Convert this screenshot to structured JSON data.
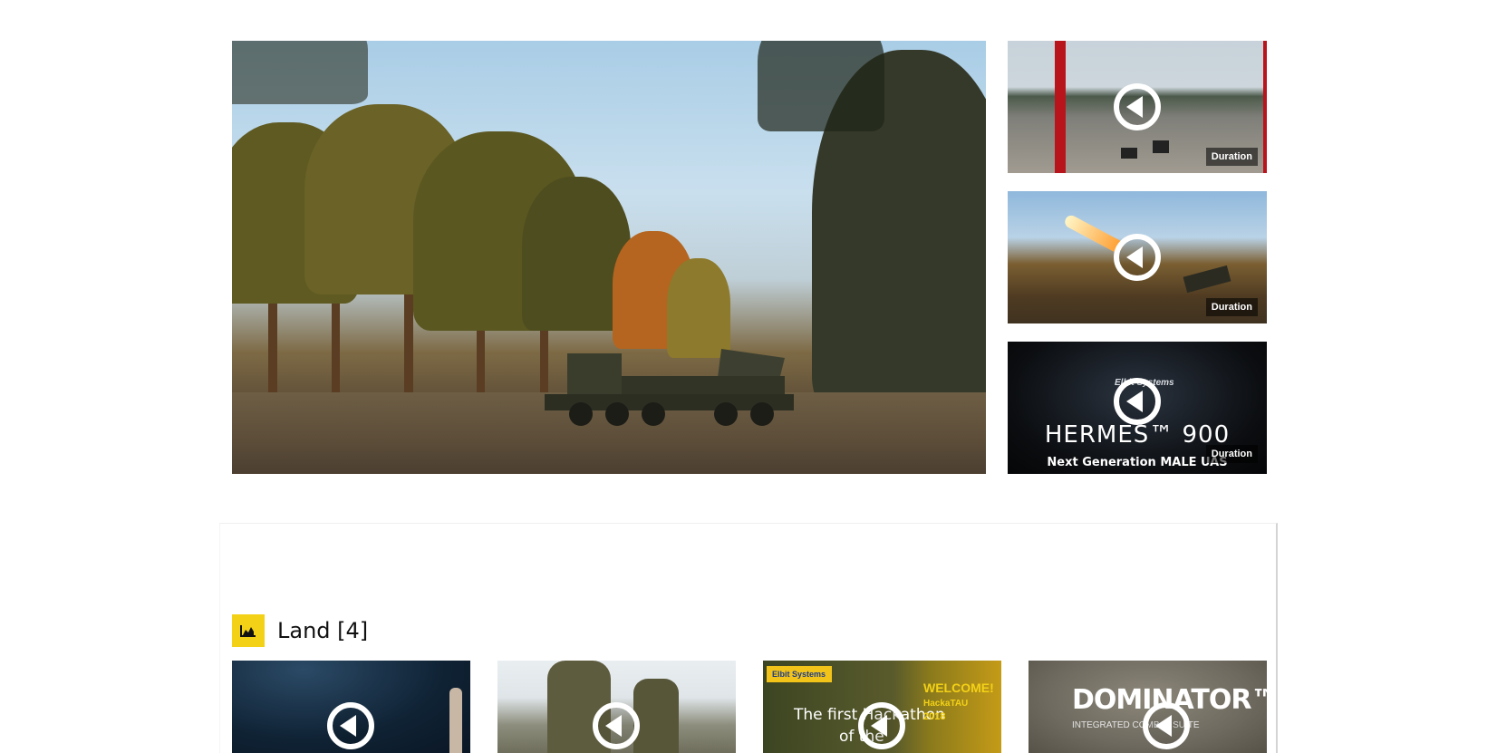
{
  "featured": {
    "side_videos": [
      {
        "duration_label": "Duration"
      },
      {
        "duration_label": "Duration"
      },
      {
        "duration_label": "Duration",
        "overlay_title": "HERMES™ 900",
        "overlay_subtitle": "Next Generation MALE UAS",
        "logo_text": "Elbit Systems"
      }
    ]
  },
  "section": {
    "icon": "area-chart-icon",
    "title": "Land [4]",
    "accent_color": "#f3d117",
    "videos": [
      {
        "caption": ""
      },
      {
        "caption": ""
      },
      {
        "caption_line1": "The first Hackathon",
        "caption_line2": "of the",
        "badge": "WELCOME!",
        "badge_sub": "HackaTAU",
        "badge_year": "2018",
        "logo_text": "Elbit Systems"
      },
      {
        "caption": "DOMINATOR™",
        "caption_sub": "INTEGRATED COMBAT SUITE"
      }
    ]
  }
}
